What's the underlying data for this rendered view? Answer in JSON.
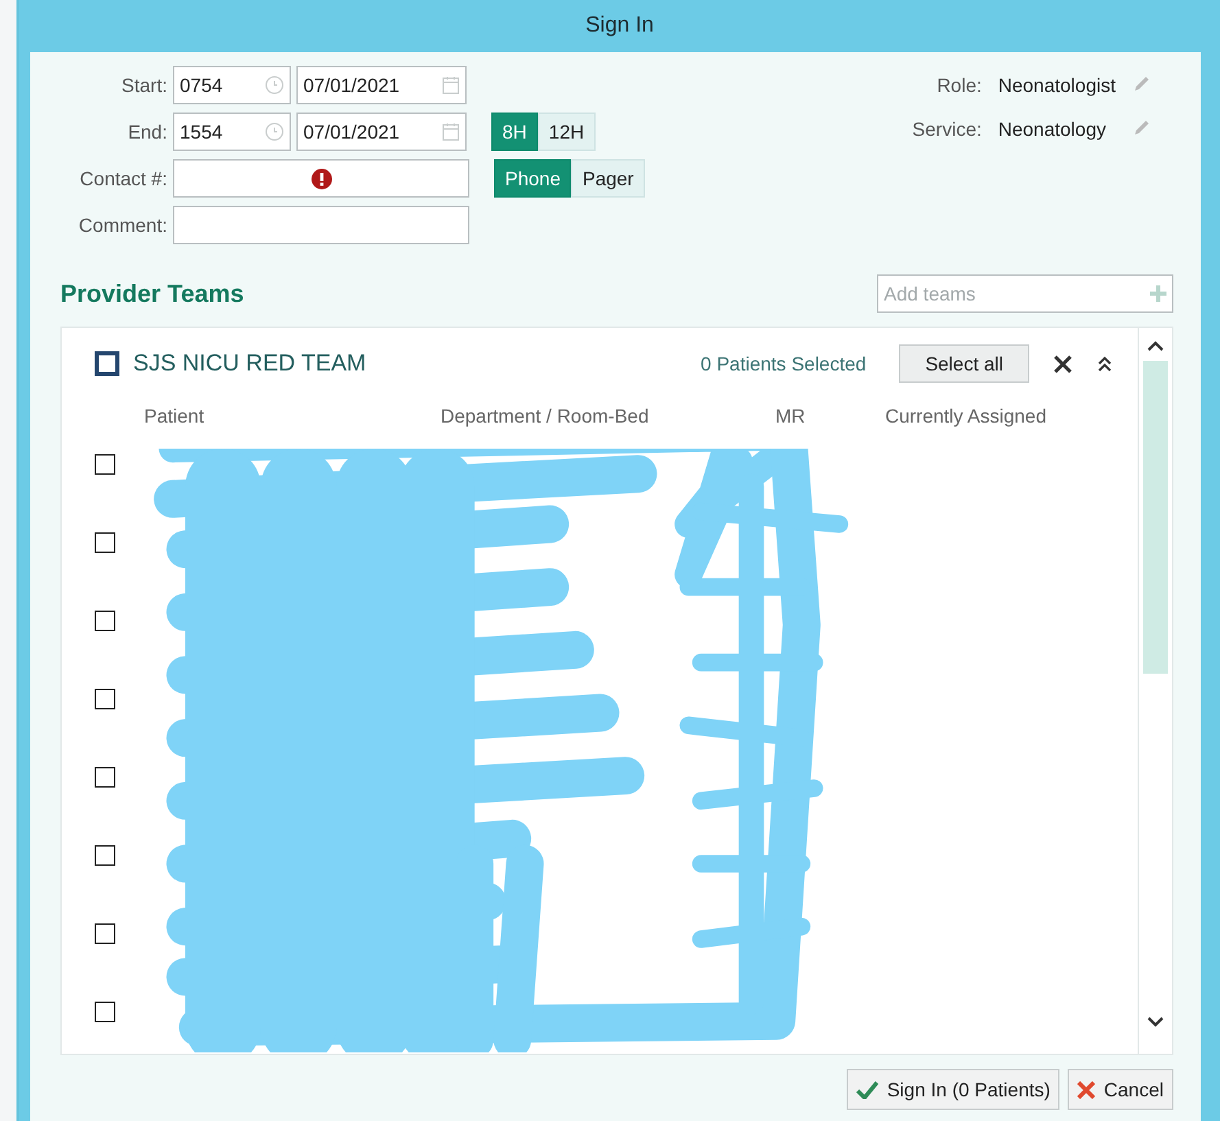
{
  "window": {
    "title": "Sign In"
  },
  "form": {
    "start": {
      "label": "Start:",
      "time": "0754",
      "date": "07/01/2021"
    },
    "end": {
      "label": "End:",
      "time": "1554",
      "date": "07/01/2021"
    },
    "contact": {
      "label": "Contact #:",
      "error": true
    },
    "comment": {
      "label": "Comment:"
    },
    "shift_buttons": [
      {
        "label": "8H",
        "selected": true
      },
      {
        "label": "12H",
        "selected": false
      }
    ],
    "contact_buttons": [
      {
        "label": "Phone",
        "selected": true
      },
      {
        "label": "Pager",
        "selected": false
      }
    ],
    "role": {
      "label": "Role:",
      "value": "Neonatologist"
    },
    "service": {
      "label": "Service:",
      "value": "Neonatology"
    }
  },
  "provider_teams": {
    "title": "Provider Teams",
    "add_placeholder": "Add teams"
  },
  "team": {
    "name": "SJS NICU RED TEAM",
    "checked": false,
    "selected_count": "0 Patients Selected",
    "select_all": "Select all",
    "columns": [
      "Patient",
      "Department / Room-Bed",
      "MR",
      "Currently Assigned"
    ],
    "rows": [
      {
        "checked": false
      },
      {
        "checked": false
      },
      {
        "checked": false
      },
      {
        "checked": false
      },
      {
        "checked": false
      },
      {
        "checked": false
      },
      {
        "checked": false
      },
      {
        "checked": false
      }
    ]
  },
  "buttons": [
    {
      "kind": "confirm",
      "label": "Sign In (0 Patients)"
    },
    {
      "kind": "cancel",
      "label": "Cancel"
    }
  ]
}
